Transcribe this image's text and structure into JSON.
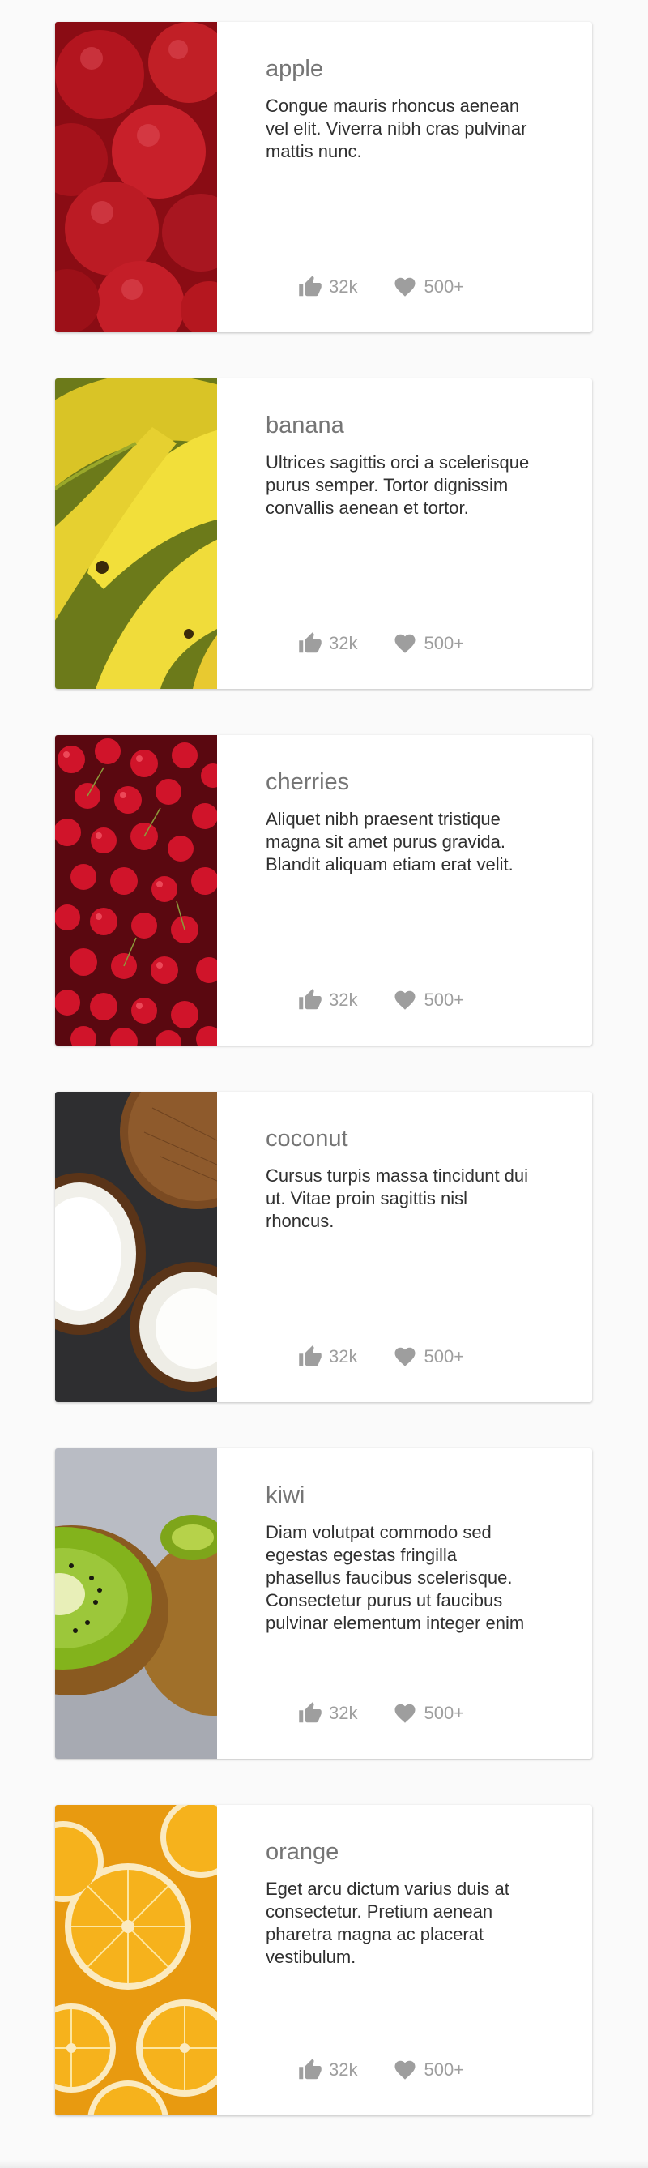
{
  "cards": [
    {
      "title": "apple",
      "description": "Congue mauris rhoncus aenean vel elit. Viverra nibh cras pulvinar mattis nunc.",
      "likes": "32k",
      "favorites": "500+",
      "image": "apple-photo"
    },
    {
      "title": "banana",
      "description": "Ultrices sagittis orci a scelerisque purus semper. Tortor dignissim convallis aenean et tortor.",
      "likes": "32k",
      "favorites": "500+",
      "image": "banana-photo"
    },
    {
      "title": "cherries",
      "description": "Aliquet nibh praesent tristique magna sit amet purus gravida. Blandit aliquam etiam erat velit.",
      "likes": "32k",
      "favorites": "500+",
      "image": "cherries-photo"
    },
    {
      "title": "coconut",
      "description": "Cursus turpis massa tincidunt dui ut. Vitae proin sagittis nisl rhoncus.",
      "likes": "32k",
      "favorites": "500+",
      "image": "coconut-photo"
    },
    {
      "title": "kiwi",
      "description": "Diam volutpat commodo sed egestas egestas fringilla phasellus faucibus scelerisque. Consectetur purus ut faucibus pulvinar elementum integer enim",
      "likes": "32k",
      "favorites": "500+",
      "image": "kiwi-photo"
    },
    {
      "title": "orange",
      "description": "Eget arcu dictum varius duis at consectetur. Pretium aenean pharetra magna ac placerat vestibulum.",
      "likes": "32k",
      "favorites": "500+",
      "image": "orange-photo"
    }
  ],
  "icons": {
    "like": "thumb-up-icon",
    "favorite": "heart-icon"
  },
  "colors": {
    "background": "#fafafa",
    "card": "#ffffff",
    "title": "#757575",
    "text": "#303030",
    "icon": "#9e9e9e"
  }
}
